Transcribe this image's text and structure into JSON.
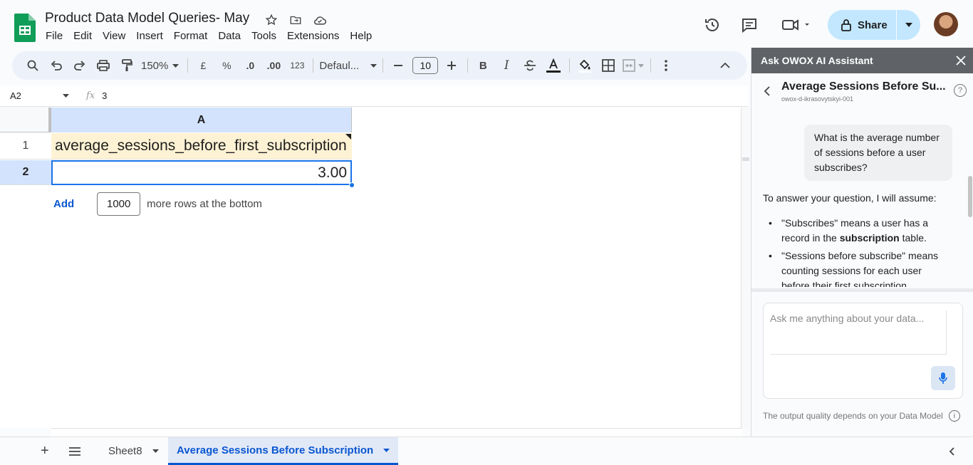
{
  "app": {
    "doc_title": "Product Data Model Queries- May",
    "menu": [
      "File",
      "Edit",
      "View",
      "Insert",
      "Format",
      "Data",
      "Tools",
      "Extensions",
      "Help"
    ],
    "share_label": "Share"
  },
  "toolbar": {
    "zoom": "150%",
    "currency": "£",
    "percent": "%",
    "decrease_decimals": ".0",
    "increase_decimals": ".00",
    "number_format": "123",
    "font_name": "Defaul...",
    "font_size": "10",
    "bold": "B",
    "italic": "I"
  },
  "formula_bar": {
    "cell_ref": "A2",
    "fx": "fx",
    "value": "3"
  },
  "sheet": {
    "column_header": "A",
    "rows": [
      {
        "num": "1",
        "value": "average_sessions_before_first_subscription"
      },
      {
        "num": "2",
        "value": "3.00"
      }
    ],
    "add_label": "Add",
    "add_count": "1000",
    "add_suffix": "more rows at the bottom"
  },
  "tabs": {
    "add_icon": "+",
    "inactive": "Sheet8",
    "active": "Average Sessions Before Subscription"
  },
  "assistant": {
    "header": "Ask OWOX AI Assistant",
    "chat_title": "Average Sessions Before Su...",
    "chat_subtitle": "owox-d-ikrasovytskyi-001",
    "user_message": "What is the average number of sessions before a user subscribes?",
    "answer_intro": "To answer your question, I will assume:",
    "bullet1_a": "\"Subscribes\" means a user has a record in the ",
    "bullet1_b": "subscription",
    "bullet1_c": " table.",
    "bullet2": "\"Sessions before subscribe\" means counting sessions for each user before their first subscription",
    "input_placeholder": "Ask me anything about your data...",
    "footnote": "The output quality depends on your Data Model"
  },
  "colors": {
    "accent": "#0b57d0",
    "header_fill": "#d3e3fd",
    "share_bg": "#c2e7ff",
    "panel_header": "#5f6368",
    "cell_highlight": "#fdf2d3"
  }
}
